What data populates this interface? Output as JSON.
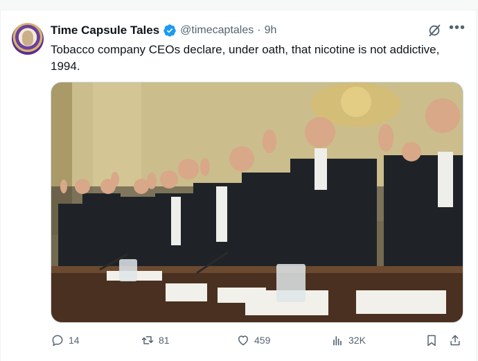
{
  "author": {
    "name": "Time Capsule Tales",
    "handle": "@timecaptales",
    "separator": "·",
    "time": "9h"
  },
  "tweet": {
    "text": "Tobacco company CEOs declare, under oath, that nicotine is not addictive, 1994."
  },
  "metrics": {
    "replies": "14",
    "reposts": "81",
    "likes": "459",
    "views": "32K"
  },
  "colors": {
    "verified": "#1d9bf0",
    "icon_gray": "#536471",
    "text": "#0f1419"
  }
}
